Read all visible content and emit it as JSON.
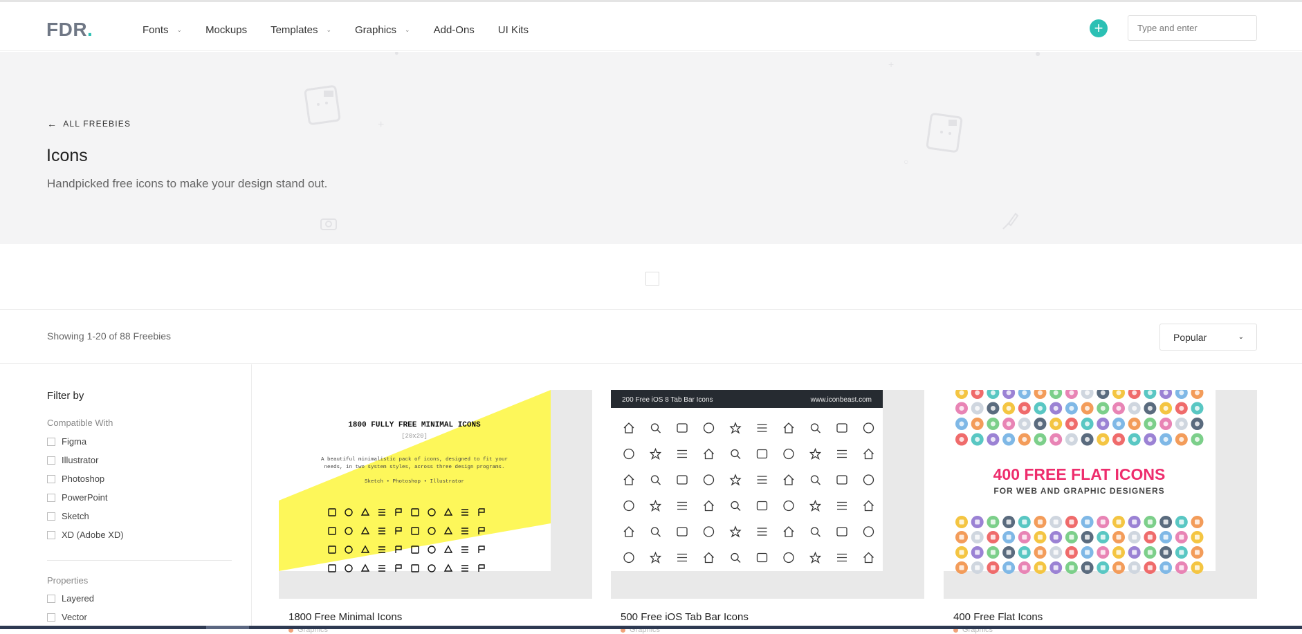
{
  "brand": {
    "logo_text": "FDR",
    "logo_dot": ".",
    "accent": "#2bc0b4"
  },
  "nav": [
    {
      "label": "Fonts",
      "dropdown": true
    },
    {
      "label": "Mockups",
      "dropdown": false
    },
    {
      "label": "Templates",
      "dropdown": true
    },
    {
      "label": "Graphics",
      "dropdown": true
    },
    {
      "label": "Add-Ons",
      "dropdown": false
    },
    {
      "label": "UI Kits",
      "dropdown": false
    }
  ],
  "header": {
    "plus_icon": "+",
    "search_placeholder": "Type and enter"
  },
  "hero": {
    "back_label": "ALL FREEBIES",
    "title": "Icons",
    "description": "Handpicked free icons to make your design stand out."
  },
  "results": {
    "text": "Showing 1-20 of 88 Freebies",
    "sort_value": "Popular"
  },
  "filters": {
    "title": "Filter by",
    "compatible_label": "Compatible With",
    "compatible": [
      "Figma",
      "Illustrator",
      "Photoshop",
      "PowerPoint",
      "Sketch",
      "XD (Adobe XD)"
    ],
    "properties_label": "Properties",
    "properties": [
      "Layered",
      "Vector"
    ]
  },
  "cards": [
    {
      "title": "1800 Free Minimal Icons",
      "category": "Graphics",
      "thumb_heading": "1800 FULLY FREE MINIMAL ICONS",
      "thumb_sub": "[20x20]",
      "thumb_desc": "A beautiful minimalistic pack of icons, designed to fit your needs, in two system styles, across three design programs.",
      "thumb_tools": "Sketch • Photoshop • Illustrator"
    },
    {
      "title": "500 Free iOS Tab Bar Icons",
      "category": "Graphics",
      "thumb_left": "200 Free iOS 8 Tab Bar Icons",
      "thumb_right": "www.iconbeast.com"
    },
    {
      "title": "400 Free Flat Icons",
      "category": "Graphics",
      "thumb_heading": "400 FREE FLAT ICONS",
      "thumb_sub": "FOR WEB AND GRAPHIC DESIGNERS"
    }
  ]
}
